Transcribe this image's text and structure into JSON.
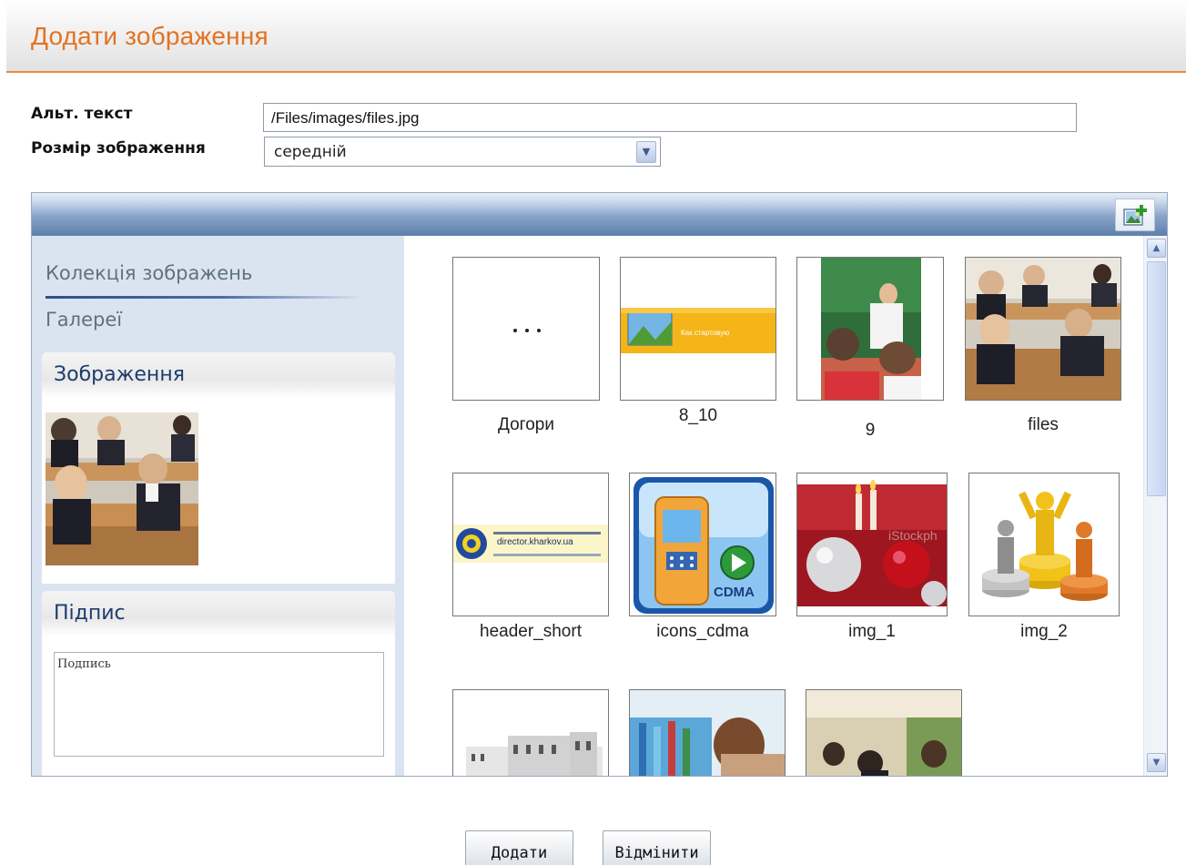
{
  "dialog": {
    "title": "Додати зображення"
  },
  "form": {
    "alt_label": "Альт. текст",
    "alt_value": "/Files/images/files.jpg",
    "size_label": "Розмір зображення",
    "size_value": "середній"
  },
  "sidebar": {
    "nav": [
      {
        "label": "Колекція зображень",
        "active": true
      },
      {
        "label": "Галереї",
        "active": false
      }
    ],
    "image_box_title": "Зображення",
    "caption_box_title": "Підпис",
    "caption_value": "Подпись"
  },
  "gallery": {
    "items": [
      {
        "label": "Догори",
        "icon": "ellipsis-icon"
      },
      {
        "label": "8_10",
        "overlay_text": "Как стартовую"
      },
      {
        "label": "9"
      },
      {
        "label": "files"
      },
      {
        "label": "header_short",
        "overlay_text": "director.kharkov.ua"
      },
      {
        "label": "icons_cdma",
        "overlay_text": "CDMA"
      },
      {
        "label": "img_1",
        "overlay_text": "iStockph"
      },
      {
        "label": "img_2"
      },
      {
        "label": ""
      },
      {
        "label": ""
      },
      {
        "label": ""
      }
    ]
  },
  "toolbar": {
    "add_image_icon": "add-image-icon"
  },
  "buttons": {
    "add": "Додати",
    "cancel": "Відмінити"
  },
  "colors": {
    "accent": "#e27324",
    "panel_blue": "#5d7fab",
    "sidebar_bg": "#dae4f1"
  }
}
